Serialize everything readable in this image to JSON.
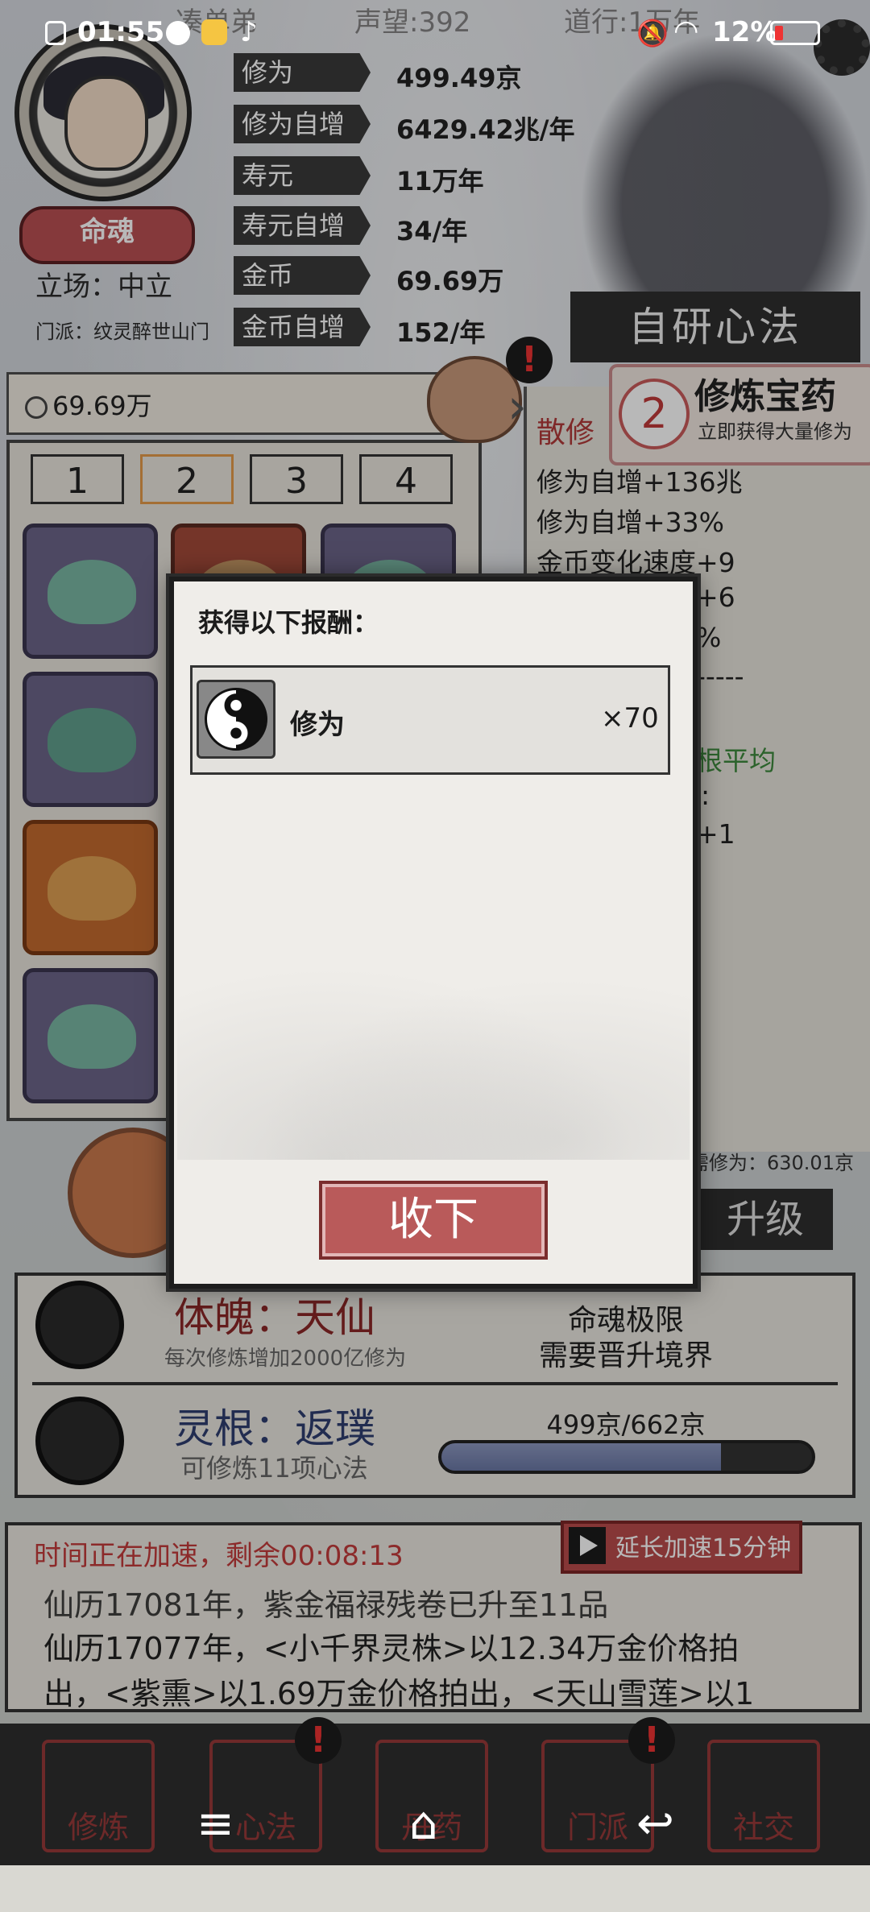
{
  "status_bar": {
    "time": "01:55",
    "battery": "12%"
  },
  "header": {
    "player_name": "凑单弟",
    "reputation": "声望:392",
    "dao": "道行:1万年",
    "soul_badge": "命魂",
    "stance": "立场：中立",
    "sect": "门派：纹灵醉世山门",
    "stats": [
      {
        "label": "修为",
        "value": "499.49京"
      },
      {
        "label": "修为自增",
        "value": "6429.42兆/年"
      },
      {
        "label": "寿元",
        "value": "11万年"
      },
      {
        "label": "寿元自增",
        "value": "34/年"
      },
      {
        "label": "金币",
        "value": "69.69万"
      },
      {
        "label": "金币自增",
        "value": "152/年"
      }
    ],
    "self_method": "自研心法"
  },
  "inventory": {
    "coins": "69.69万",
    "tabs": [
      "1",
      "2",
      "3",
      "4"
    ],
    "active_tab": 1
  },
  "info_panel": {
    "pill_count": "2",
    "pill_title": "修炼宝药",
    "pill_sub": "立即获得大量修为",
    "name": "散修",
    "lines": [
      "修为自增+136兆",
      "修为自增+33%",
      "金币变化速度+9",
      "+6",
      "%",
      "-----",
      "根平均",
      ":",
      "+1"
    ]
  },
  "upgrade": {
    "need": "需修为：630.01京",
    "button": "升级"
  },
  "realm": {
    "body_title": "体魄：天仙",
    "body_sub": "每次修炼增加2000亿修为",
    "soul_limit_1": "命魂极限",
    "soul_limit_2": "需要晋升境界",
    "root_title": "灵根：返璞",
    "root_sub": "可修炼11项心法",
    "progress_text": "499京/662京",
    "progress": 0.754
  },
  "log": {
    "speed_text": "时间正在加速，剩余00:08:13",
    "extend_button": "延长加速15分钟",
    "lines": [
      "仙历17081年，紫金福禄残卷已升至11品",
      "仙历17077年，<小千界灵株>以12.34万金价格拍",
      "出，<紫熏>以1.69万金价格拍出，<天山雪莲>以1"
    ]
  },
  "nav": {
    "tabs": [
      "修炼",
      "心法",
      "丹药",
      "门派",
      "社交"
    ]
  },
  "modal": {
    "title": "获得以下报酬：",
    "reward_name": "修为",
    "reward_qty": "×70",
    "accept": "收下"
  },
  "colors": {
    "accent_red": "#b95a5a",
    "modal_bg": "#efede9"
  }
}
